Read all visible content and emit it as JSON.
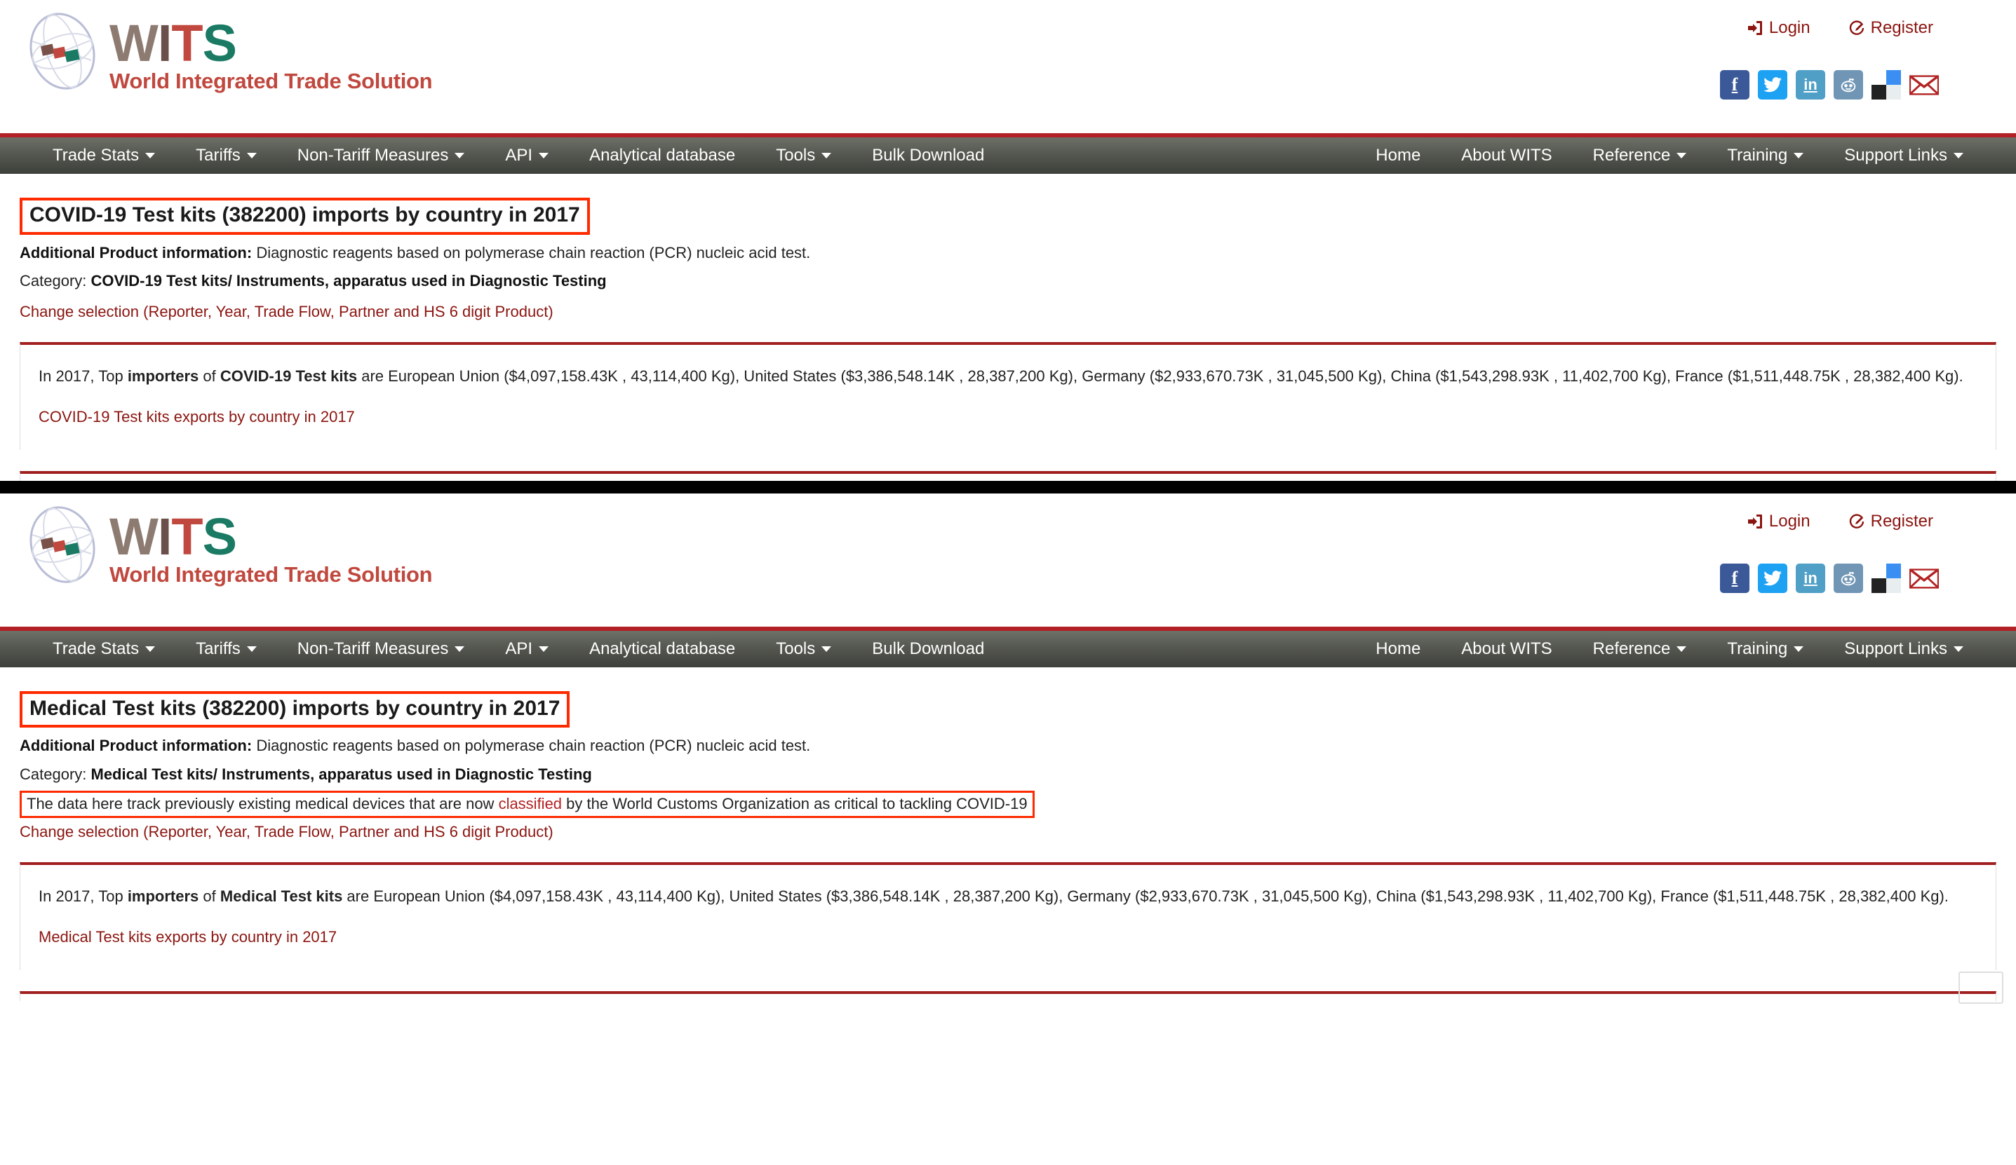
{
  "brand": {
    "logo_w": "W",
    "logo_i": "I",
    "logo_t": "T",
    "logo_s": "S",
    "tagline": "World Integrated Trade Solution"
  },
  "auth": {
    "login": "Login",
    "register": "Register"
  },
  "social": [
    {
      "name": "facebook",
      "glyph": "f"
    },
    {
      "name": "twitter",
      "glyph": ""
    },
    {
      "name": "linkedin",
      "glyph": "in"
    },
    {
      "name": "reddit",
      "glyph": ""
    },
    {
      "name": "delicious",
      "glyph": ""
    },
    {
      "name": "email",
      "glyph": ""
    }
  ],
  "nav": {
    "left": [
      {
        "label": "Trade Stats",
        "caret": true
      },
      {
        "label": "Tariffs",
        "caret": true
      },
      {
        "label": "Non-Tariff Measures",
        "caret": true
      },
      {
        "label": "API",
        "caret": true
      },
      {
        "label": "Analytical database",
        "caret": false
      },
      {
        "label": "Tools",
        "caret": true
      },
      {
        "label": "Bulk Download",
        "caret": false
      }
    ],
    "right": [
      {
        "label": "Home",
        "caret": false
      },
      {
        "label": "About WITS",
        "caret": false
      },
      {
        "label": "Reference",
        "caret": true
      },
      {
        "label": "Training",
        "caret": true
      },
      {
        "label": "Support Links",
        "caret": true
      }
    ]
  },
  "colors": {
    "brand_red": "#b32025",
    "link_red": "#8b1510",
    "annotation_red": "#ff2a00",
    "navbar_dark": "#3d3f3a"
  },
  "section_one": {
    "title": "COVID-19 Test kits (382200) imports by country in 2017",
    "additional_label": "Additional Product information:",
    "additional_text": " Diagnostic reagents based on polymerase chain reaction (PCR) nucleic acid test.",
    "category_label": "Category: ",
    "category_value": "COVID-19 Test kits/ Instruments, apparatus used in Diagnostic Testing",
    "change_selection": "Change selection (Reporter, Year, Trade Flow, Partner and HS 6 digit Product)",
    "result_prefix": "In 2017, Top ",
    "result_importers": "importers",
    "result_of": " of ",
    "result_product": "COVID-19 Test kits",
    "result_body": " are European Union ($4,097,158.43K , 43,114,400 Kg), United States ($3,386,548.14K , 28,387,200 Kg), Germany ($2,933,670.73K , 31,045,500 Kg), China ($1,543,298.93K , 11,402,700 Kg), France ($1,511,448.75K , 28,382,400 Kg).",
    "export_link": "COVID-19 Test kits exports by country in 2017"
  },
  "section_two": {
    "title": "Medical Test kits (382200) imports by country in 2017",
    "additional_label": "Additional Product information:",
    "additional_text": " Diagnostic reagents based on polymerase chain reaction (PCR) nucleic acid test.",
    "category_label": "Category: ",
    "category_value": "Medical Test kits/ Instruments, apparatus used in Diagnostic Testing",
    "note_prefix": "The data here track previously existing medical devices that are now ",
    "note_link": "classified",
    "note_suffix": " by the World Customs Organization as critical to tackling COVID-19",
    "change_selection": "Change selection (Reporter, Year, Trade Flow, Partner and HS 6 digit Product)",
    "result_prefix": "In 2017, Top ",
    "result_importers": "importers",
    "result_of": " of ",
    "result_product": "Medical Test kits",
    "result_body": " are European Union ($4,097,158.43K , 43,114,400 Kg), United States ($3,386,548.14K , 28,387,200 Kg), Germany ($2,933,670.73K , 31,045,500 Kg), China ($1,543,298.93K , 11,402,700 Kg), France ($1,511,448.75K , 28,382,400 Kg).",
    "export_link": "Medical Test kits exports by country in 2017"
  }
}
